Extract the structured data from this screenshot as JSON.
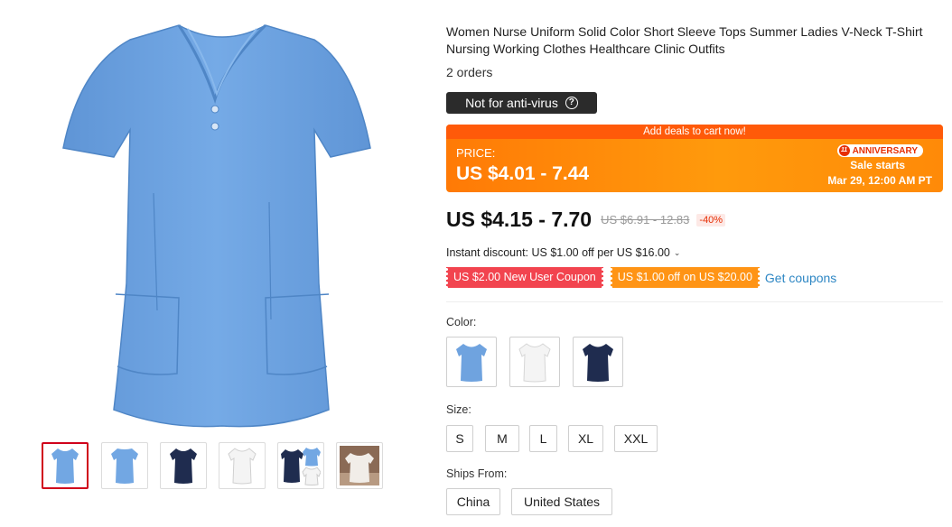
{
  "product": {
    "title_line1": "Women Nurse Uniform Solid Color Short Sleeve Tops Summer Ladies V-Neck T-Shirt",
    "title_line2": "Nursing Working Clothes Healthcare Clinic Outfits",
    "orders": "2 orders",
    "badge_label": "Not for anti-virus",
    "badge_icon": "question-circle-icon"
  },
  "promo": {
    "banner_text": "Add deals to cart now!",
    "price_label": "PRICE:",
    "price_range": "US $4.01 - 7.44",
    "event_badge": "ANNIVERSARY",
    "event_logo": "11",
    "sale_line1": "Sale starts",
    "sale_line2": "Mar 29, 12:00 AM PT",
    "colors": {
      "bar": "#ff5a09",
      "background": "#ff8a08"
    }
  },
  "pricing": {
    "current": "US $4.15 - 7.70",
    "original": "US $6.91 - 12.83",
    "discount": "-40%",
    "instant_discount": "Instant discount: US $1.00 off per US $16.00",
    "coupons": [
      "US $2.00 New User Coupon",
      "US $1.00 off on US $20.00"
    ],
    "get_coupons": "Get coupons"
  },
  "options": {
    "color_label": "Color:",
    "colors": [
      {
        "name": "light-blue",
        "hex": "#6fa3df"
      },
      {
        "name": "white",
        "hex": "#f4f4f4"
      },
      {
        "name": "navy",
        "hex": "#1f2c4f"
      }
    ],
    "size_label": "Size:",
    "sizes": [
      "S",
      "M",
      "L",
      "XL",
      "XXL"
    ],
    "ships_label": "Ships From:",
    "ships_from": [
      "China",
      "United States"
    ]
  },
  "gallery": {
    "main_color": "#72a7e3",
    "thumbs": [
      "light-blue-front",
      "light-blue-back",
      "navy-front",
      "white-front",
      "navy-multi",
      "photo"
    ]
  }
}
